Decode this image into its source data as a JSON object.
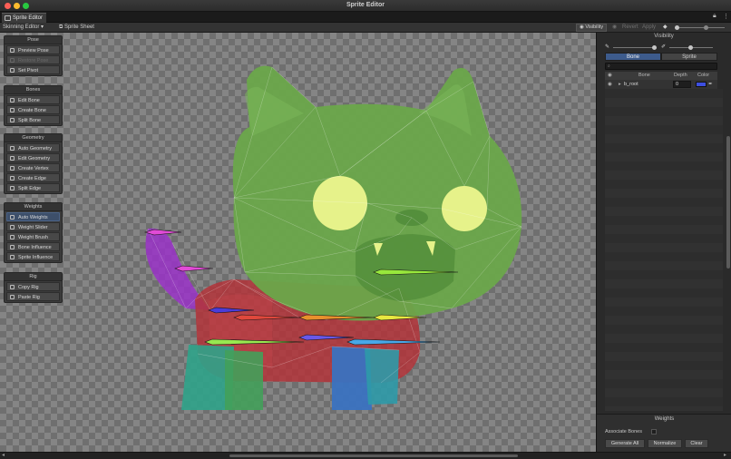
{
  "window": {
    "title": "Sprite Editor"
  },
  "tab": {
    "label": "Sprite Editor"
  },
  "toolbar": {
    "mode": "Skinning Editor",
    "sprite_sheet": "Sprite Sheet",
    "visibility": "Visibility",
    "revert": "Revert",
    "apply": "Apply"
  },
  "tool_groups": {
    "pose": {
      "title": "Pose",
      "items": [
        "Preview Pose",
        "Restore Pose",
        "Set Pivot"
      ]
    },
    "bones": {
      "title": "Bones",
      "items": [
        "Edit Bone",
        "Create Bone",
        "Split Bone"
      ]
    },
    "geometry": {
      "title": "Geometry",
      "items": [
        "Auto Geometry",
        "Edit Geometry",
        "Create Vertex",
        "Create Edge",
        "Split Edge"
      ]
    },
    "weights": {
      "title": "Weights",
      "items": [
        "Auto Weights",
        "Weight Slider",
        "Weight Brush",
        "Bone Influence",
        "Sprite Influence"
      ]
    },
    "rig": {
      "title": "Rig",
      "items": [
        "Copy Rig",
        "Paste Rig"
      ]
    }
  },
  "visibility_panel": {
    "title": "Visibility",
    "tabs": [
      "Bone",
      "Sprite"
    ],
    "columns": [
      "Bone",
      "Depth",
      "Color"
    ],
    "rows": [
      {
        "name": "b_root",
        "depth": "0",
        "color": "#3d4fe0"
      }
    ]
  },
  "weights_panel": {
    "title": "Weights",
    "associate_bones": "Associate Bones",
    "buttons": [
      "Generate All",
      "Normalize",
      "Clear"
    ]
  },
  "bone_colors": [
    "#e14bd6",
    "#e14bd6",
    "#4b3cd8",
    "#e0483c",
    "#e8902c",
    "#e8e840",
    "#98e83c",
    "#6a58e8",
    "#48a8e8",
    "#98e850"
  ]
}
